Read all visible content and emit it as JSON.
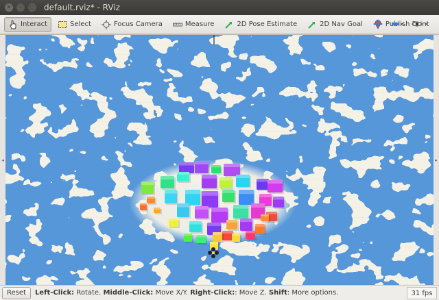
{
  "window": {
    "title": "default.rviz* - RViz"
  },
  "toolbar": {
    "tools": [
      {
        "label": "Interact",
        "icon": "hand-cursor-icon",
        "active": true
      },
      {
        "label": "Select",
        "icon": "select-rect-icon",
        "active": false
      },
      {
        "label": "Focus Camera",
        "icon": "crosshair-icon",
        "active": false
      },
      {
        "label": "Measure",
        "icon": "ruler-icon",
        "active": false
      },
      {
        "label": "2D Pose Estimate",
        "icon": "green-arrow-icon",
        "active": false
      },
      {
        "label": "2D Nav Goal",
        "icon": "green-arrow-icon",
        "active": false
      },
      {
        "label": "Publish Point",
        "icon": "map-pin-icon",
        "active": false
      }
    ],
    "right_icons": [
      "add-tool-icon",
      "remove-tool-icon",
      "eye-icon"
    ]
  },
  "status": {
    "reset_label": "Reset",
    "hint_segments": [
      {
        "text": "Left-Click:",
        "bold": true
      },
      {
        "text": " Rotate. ",
        "bold": false
      },
      {
        "text": "Middle-Click:",
        "bold": true
      },
      {
        "text": " Move X/Y. ",
        "bold": false
      },
      {
        "text": "Right-Click:",
        "bold": true
      },
      {
        "text": ": Move Z. ",
        "bold": false
      },
      {
        "text": "Shift",
        "bold": true
      },
      {
        "text": ": More options.",
        "bold": false
      }
    ],
    "fps": "31 fps"
  },
  "colors": {
    "map_blue": "#4a90d8",
    "map_light": "#f4f1e6",
    "accent_green": "#2bb44a"
  }
}
